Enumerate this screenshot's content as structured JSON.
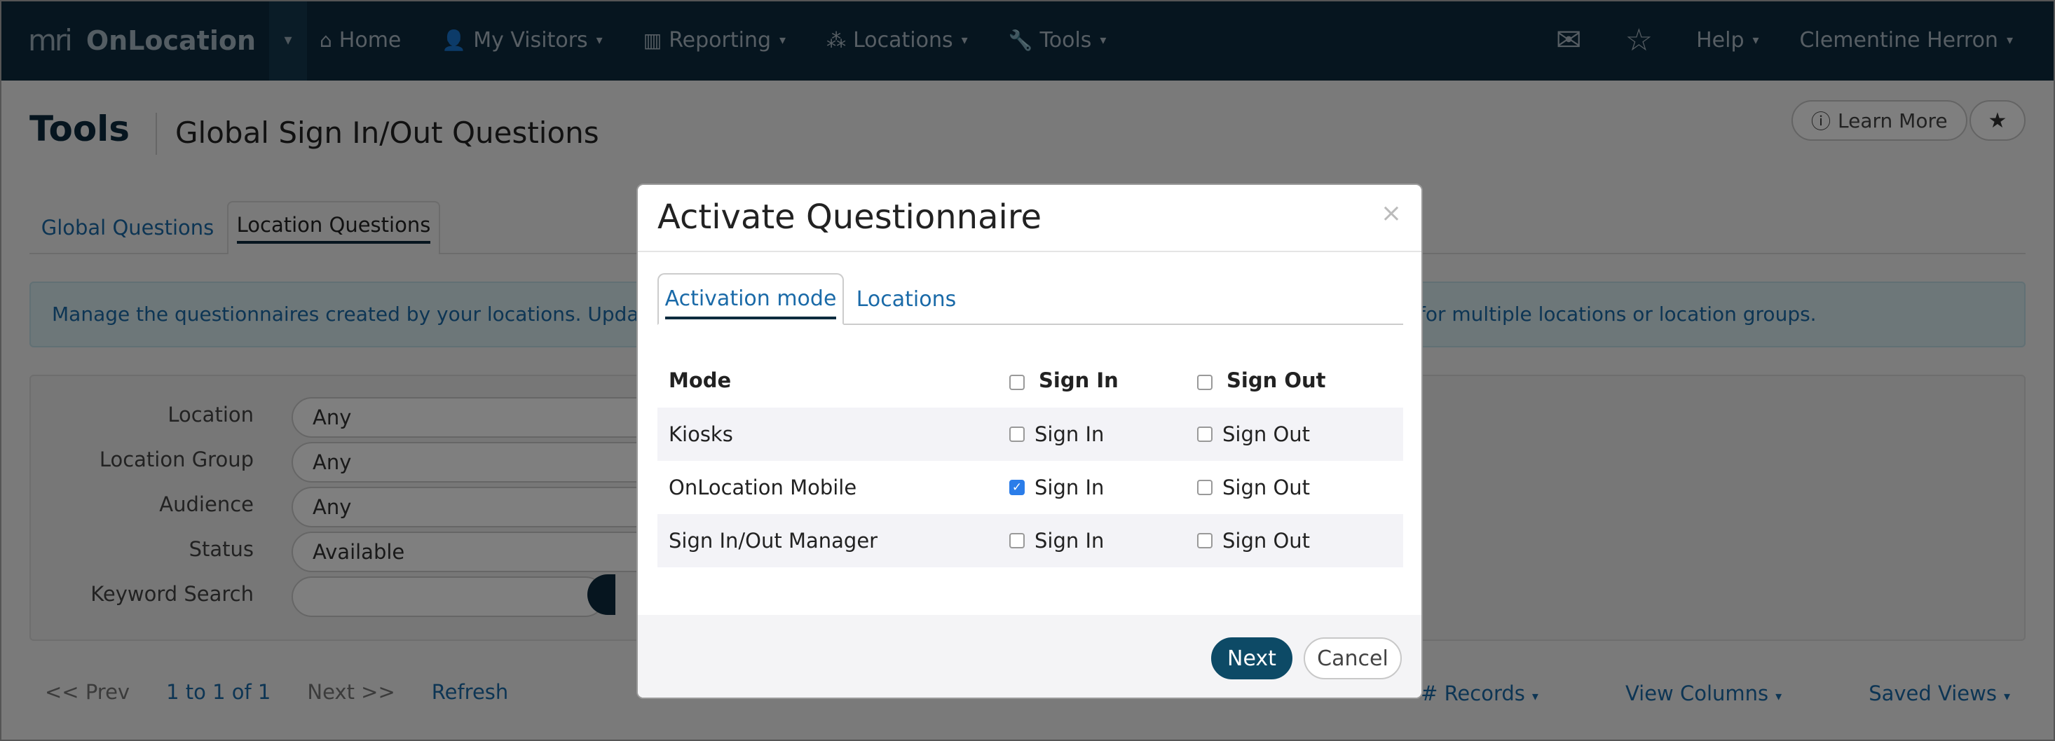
{
  "topnav": {
    "logo": "mri",
    "brand": "OnLocation",
    "items": [
      {
        "label": "Home",
        "icon": "home-icon",
        "glyph": "⌂"
      },
      {
        "label": "My Visitors",
        "icon": "user-icon",
        "glyph": "👤"
      },
      {
        "label": "Reporting",
        "icon": "bar-chart-icon",
        "glyph": "▥"
      },
      {
        "label": "Locations",
        "icon": "network-icon",
        "glyph": "⁂"
      },
      {
        "label": "Tools",
        "icon": "wrench-icon",
        "glyph": "🔧"
      }
    ],
    "help": "Help",
    "user": "Clementine Herron"
  },
  "page": {
    "title": "Tools",
    "subtitle": "Global Sign In/Out Questions",
    "learn_more": "Learn More",
    "tabs": [
      "Global Questions",
      "Location Questions"
    ],
    "info_left": "Manage the questionnaires created by your locations. Update q",
    "info_right": "for multiple locations or location groups.",
    "filters": [
      {
        "label": "Location",
        "value": "Any"
      },
      {
        "label": "Location Group",
        "value": "Any"
      },
      {
        "label": "Audience",
        "value": "Any"
      },
      {
        "label": "Status",
        "value": "Available"
      },
      {
        "label": "Keyword Search",
        "value": ""
      }
    ],
    "pager": {
      "prev": "<< Prev",
      "range": "1 to 1 of 1",
      "next": "Next >>",
      "refresh": "Refresh"
    },
    "right_tools": [
      "# Records",
      "View Columns",
      "Saved Views"
    ]
  },
  "modal": {
    "title": "Activate Questionnaire",
    "close": "×",
    "tabs": [
      "Activation mode",
      "Locations"
    ],
    "header": {
      "mode": "Mode",
      "sign_in": "Sign In",
      "sign_out": "Sign Out"
    },
    "rows": [
      {
        "mode": "Kiosks",
        "sign_in": "Sign In",
        "sign_out": "Sign Out",
        "sign_in_checked": false,
        "sign_out_checked": false
      },
      {
        "mode": "OnLocation Mobile",
        "sign_in": "Sign In",
        "sign_out": "Sign Out",
        "sign_in_checked": true,
        "sign_out_checked": false
      },
      {
        "mode": "Sign In/Out Manager",
        "sign_in": "Sign In",
        "sign_out": "Sign Out",
        "sign_in_checked": false,
        "sign_out_checked": false
      }
    ],
    "next": "Next",
    "cancel": "Cancel"
  },
  "colors": {
    "nav_bg": "#0d2b3e",
    "link": "#1a6aa8",
    "primary_button": "#0d4a66",
    "checkbox_checked": "#2b7de9"
  }
}
